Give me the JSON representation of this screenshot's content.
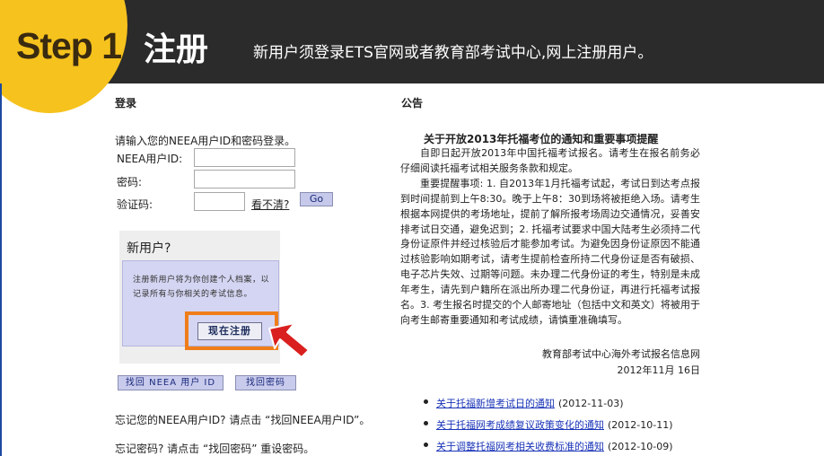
{
  "header": {
    "step_label": "Step 1",
    "title": "注册",
    "description": "新用户须登录ETS官网或者教育部考试中心,网上注册用户。"
  },
  "login": {
    "section_title": "登录",
    "prompt": "请输入您的NEEA用户ID和密码登录。",
    "userid_label": "NEEA用户ID:",
    "password_label": "密码:",
    "captcha_label": "验证码:",
    "captcha_refresh": "看不清?",
    "go_button": "Go"
  },
  "new_user": {
    "title": "新用户?",
    "description": "注册新用户将为你创建个人档案，以记录所有与你相关的考试信息。",
    "register_button": "现在注册"
  },
  "recovery": {
    "find_id_button": "找回 NEEA 用户 ID",
    "find_password_button": "找回密码",
    "forgot_id_hint": "忘记您的NEEA用户ID? 请点击 “找回NEEA用户ID”。",
    "forgot_password_hint": "忘记密码? 请点击 “找回密码” 重设密码。"
  },
  "notice": {
    "section_title": "公告",
    "headline": "关于开放2013年托福考位的通知和重要事项提醒",
    "paragraphs": [
      "自即日起开放2013年中国托福考试报名。请考生在报名前务必仔细阅读托福考试相关服务条款和规定。",
      "重要提醒事项: 1. 自2013年1月托福考试起，考试日到达考点报到时间提前到上午8:30。晚于上午8：30到场将被拒绝入场。请考生根据本网提供的考场地址，提前了解所报考场周边交通情况，妥善安排考试日交通，避免迟到；2. 托福考试要求中国大陆考生必须持二代身份证原件并经过核验后才能参加考试。为避免因身份证原因不能通过核验影响如期考试，请考生提前检查所持二代身份证是否有破损、电子芯片失效、过期等问题。未办理二代身份证的考生，特别是未成年考生，请先到户籍所在派出所办理二代身份证，再进行托福考试报名。3. 考生报名时提交的个人邮寄地址（包括中文和英文）将被用于向考生邮寄重要通知和考试成绩，请慎重准确填写。"
    ],
    "signature": "教育部考试中心海外考试报名信息网",
    "date": "2012年11月 16日"
  },
  "news": [
    {
      "title": "关于托福新增考试日的通知",
      "date": "(2012-11-03)"
    },
    {
      "title": "关于托福网考成绩复议政策变化的通知",
      "date": "(2012-10-11)"
    },
    {
      "title": "关于调整托福网考相关收费标准的通知",
      "date": "(2012-10-09)"
    }
  ],
  "colors": {
    "header_bg": "#2b2b2b",
    "step_circle": "#f6c21d",
    "highlight": "#ef7d1a",
    "arrow": "#d9201e",
    "link": "#1a34b8"
  }
}
